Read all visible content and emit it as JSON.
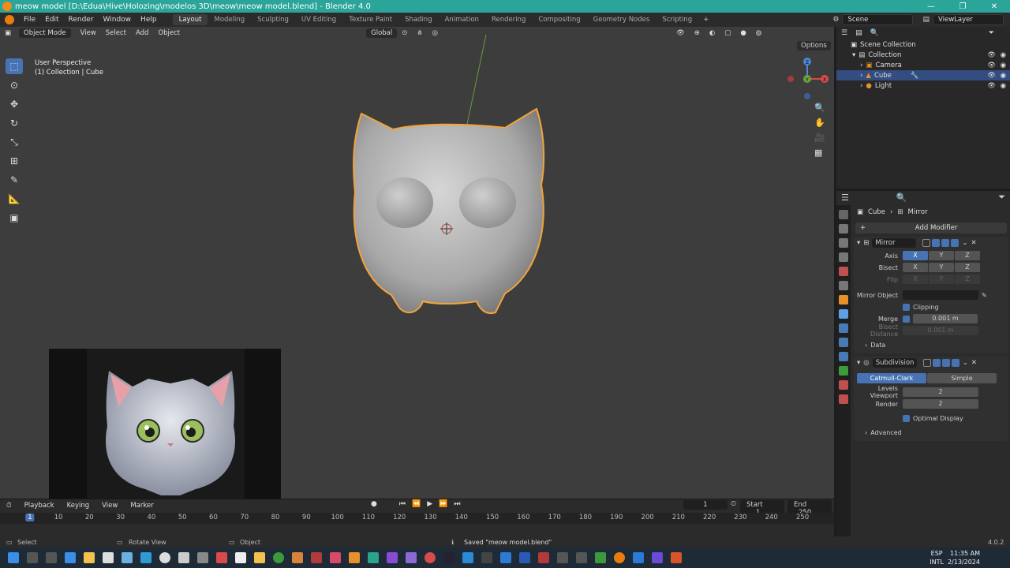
{
  "window": {
    "title": "meow model [D:\\Edua\\Hive\\Holozing\\modelos 3D\\meow\\meow model.blend] - Blender 4.0",
    "controls": [
      "—",
      "❐",
      "✕"
    ]
  },
  "menu": [
    "File",
    "Edit",
    "Render",
    "Window",
    "Help"
  ],
  "workspaces": [
    "Layout",
    "Modeling",
    "Sculpting",
    "UV Editing",
    "Texture Paint",
    "Shading",
    "Animation",
    "Rendering",
    "Compositing",
    "Geometry Nodes",
    "Scripting"
  ],
  "active_workspace": "Layout",
  "workspace_add": "+",
  "scene": {
    "scene_label": "Scene",
    "viewlayer_label": "ViewLayer"
  },
  "viewport": {
    "mode": "Object Mode",
    "header_items": [
      "View",
      "Select",
      "Add",
      "Object"
    ],
    "transform_orientation": "Global",
    "options_label": "Options",
    "info_line1": "User Perspective",
    "info_line2": "(1) Collection | Cube",
    "gizmo_axes": [
      "X",
      "Y",
      "Z"
    ]
  },
  "outliner": {
    "root": "Scene Collection",
    "items": [
      {
        "label": "Collection",
        "indent": 1
      },
      {
        "label": "Camera",
        "indent": 2
      },
      {
        "label": "Cube",
        "indent": 2,
        "selected": true
      },
      {
        "label": "Light",
        "indent": 2
      }
    ]
  },
  "properties": {
    "breadcrumb_object": "Cube",
    "breadcrumb_modifier": "Mirror",
    "add_modifier": "Add Modifier",
    "mirror": {
      "name": "Mirror",
      "axis_label": "Axis",
      "bisect_label": "Bisect",
      "flip_label": "Flip",
      "axes": [
        "X",
        "Y",
        "Z"
      ],
      "mirror_object_label": "Mirror Object",
      "clipping_label": "Clipping",
      "merge_label": "Merge",
      "merge_value": "0.001 m",
      "bisect_distance_label": "Bisect Distance",
      "bisect_distance_value": "0.001 m",
      "data_label": "Data"
    },
    "subdivision": {
      "name": "Subdivision",
      "catmull": "Catmull-Clark",
      "simple": "Simple",
      "levels_viewport_label": "Levels Viewport",
      "levels_viewport_value": "2",
      "render_label": "Render",
      "render_value": "2",
      "optimal_label": "Optimal Display",
      "advanced_label": "Advanced"
    }
  },
  "timeline": {
    "header_items": [
      "Playback",
      "Keying",
      "View",
      "Marker"
    ],
    "current_frame": "1",
    "start_label": "Start",
    "start_value": "1",
    "end_label": "End",
    "end_value": "250",
    "ticks": [
      "1",
      "10",
      "20",
      "30",
      "40",
      "50",
      "60",
      "70",
      "80",
      "90",
      "100",
      "110",
      "120",
      "130",
      "140",
      "150",
      "160",
      "170",
      "180",
      "190",
      "200",
      "210",
      "220",
      "230",
      "240",
      "250"
    ]
  },
  "statusbar": {
    "select": "Select",
    "rotate": "Rotate View",
    "object": "Object",
    "message": "Saved \"meow model.blend\"",
    "version": "4.0.2"
  },
  "taskbar": {
    "lang1": "ESP",
    "lang2": "INTL",
    "time": "11:35 AM",
    "date": "2/13/2024"
  },
  "colors": {
    "accent": "#4772b3",
    "titlebar": "#2ba49a",
    "selection_outline": "#f2a33a",
    "viewport_bg": "#3d3d3d"
  }
}
